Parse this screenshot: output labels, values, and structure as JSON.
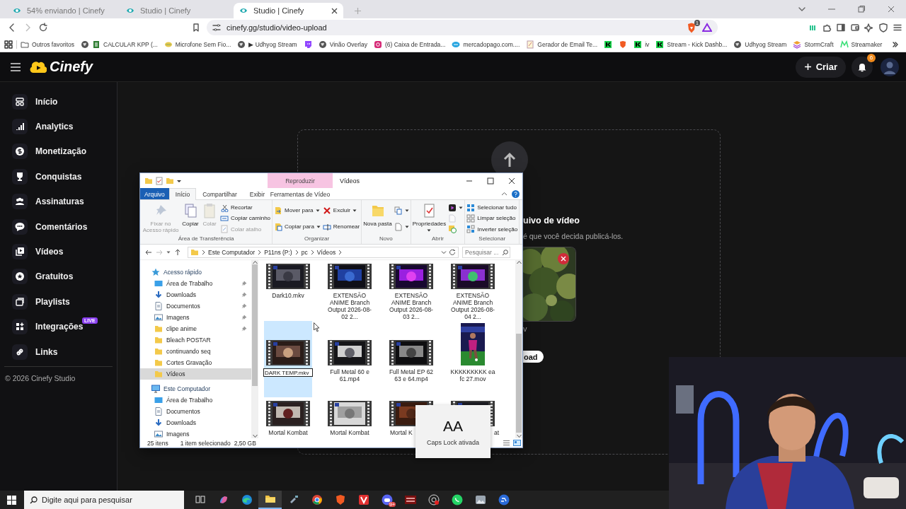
{
  "browser": {
    "tabs": [
      {
        "title": "54% enviando | Cinefy",
        "selected": false
      },
      {
        "title": "Studio | Cinefy",
        "selected": false
      },
      {
        "title": "Studio | Cinefy",
        "selected": true
      }
    ],
    "address": "cinefy.gg/studio/video-upload",
    "shield_count": "1",
    "bookmarks": [
      {
        "kind": "link",
        "label": "Outros favoritos"
      },
      {
        "kind": "link",
        "label": "CALCULAR KPP (..."
      },
      {
        "kind": "link",
        "label": "Microfone Sem Fio..."
      },
      {
        "kind": "link",
        "label": "▶ Udhyog Stream"
      },
      {
        "kind": "icon"
      },
      {
        "kind": "link",
        "label": "Vinão Overlay"
      },
      {
        "kind": "link",
        "label": "(6) Caixa de Entrada..."
      },
      {
        "kind": "link",
        "label": "mercadopago.com...."
      },
      {
        "kind": "link",
        "label": "Gerador de Email Te..."
      },
      {
        "kind": "icon"
      },
      {
        "kind": "icon"
      },
      {
        "kind": "link",
        "label": "iv"
      },
      {
        "kind": "link",
        "label": "Stream - Kick Dashb..."
      },
      {
        "kind": "link",
        "label": "Udhyog Stream"
      },
      {
        "kind": "link",
        "label": "StormCraft"
      },
      {
        "kind": "link",
        "label": "Streamaker"
      }
    ]
  },
  "studio": {
    "logo": "Cinefy",
    "create_button": "Criar",
    "notification_count": "6",
    "nav": [
      {
        "label": "Início",
        "selected": false
      },
      {
        "label": "Analytics",
        "selected": false
      },
      {
        "label": "Monetização",
        "selected": false
      },
      {
        "label": "Conquistas",
        "selected": false
      },
      {
        "label": "Assinaturas",
        "selected": false
      },
      {
        "label": "Comentários",
        "selected": false
      },
      {
        "label": "Vídeos",
        "selected": false
      },
      {
        "label": "Gratuitos",
        "selected": false
      },
      {
        "label": "Playlists",
        "selected": false
      },
      {
        "label": "Integrações",
        "badge": "LIVE",
        "selected": false
      },
      {
        "label": "Links",
        "selected": false
      }
    ],
    "footer": "© 2026 Cinefy Studio",
    "upload": {
      "title": "uivo de vídeo",
      "subtitle": "é que você decida publicá-los.",
      "file_label": "v",
      "button": "oad"
    }
  },
  "explorer": {
    "title": "Vídeos",
    "context_group": "Reproduzir",
    "tabs": [
      {
        "label": "Arquivo",
        "kind": "file",
        "selected": false
      },
      {
        "label": "Início",
        "kind": "tab",
        "selected": true
      },
      {
        "label": "Compartilhar",
        "kind": "tab",
        "selected": false
      },
      {
        "label": "Exibir",
        "kind": "tab",
        "selected": false
      },
      {
        "label": "Ferramentas de Vídeo",
        "kind": "context",
        "selected": false
      }
    ],
    "ribbon": [
      {
        "label": "Área de Transferência",
        "commands": [
          {
            "kind": "large",
            "label": "Fixar no Acesso rápido",
            "disabled": true,
            "dropdown": false
          },
          {
            "kind": "large",
            "label": "Copiar",
            "disabled": false,
            "dropdown": false
          },
          {
            "kind": "large",
            "label": "Colar",
            "disabled": true,
            "dropdown": false
          },
          {
            "kind": "small",
            "label": "Recortar",
            "disabled": false,
            "dropdown": false
          },
          {
            "kind": "small",
            "label": "Copiar caminho",
            "disabled": false,
            "dropdown": false
          },
          {
            "kind": "small",
            "label": "Colar atalho",
            "disabled": true,
            "dropdown": false
          }
        ]
      },
      {
        "label": "Organizar",
        "commands": [
          {
            "kind": "small",
            "label": "Mover para",
            "disabled": false,
            "dropdown": true
          },
          {
            "kind": "small",
            "label": "Copiar para",
            "disabled": false,
            "dropdown": true
          },
          {
            "kind": "small",
            "label": "Excluir",
            "disabled": false,
            "dropdown": true
          },
          {
            "kind": "small",
            "label": "Renomear",
            "disabled": false,
            "dropdown": false
          }
        ]
      },
      {
        "label": "Novo",
        "commands": [
          {
            "kind": "large",
            "label": "Nova pasta",
            "disabled": false,
            "dropdown": false
          },
          {
            "kind": "icon",
            "disabled": false,
            "dropdown": true
          },
          {
            "kind": "icon",
            "disabled": false,
            "dropdown": true
          }
        ]
      },
      {
        "label": "Abrir",
        "commands": [
          {
            "kind": "large",
            "label": "Propriedades",
            "disabled": false,
            "dropdown": true
          },
          {
            "kind": "icon",
            "disabled": false,
            "dropdown": true
          },
          {
            "kind": "icon",
            "disabled": true,
            "dropdown": false
          },
          {
            "kind": "icon",
            "disabled": false,
            "dropdown": false
          }
        ]
      },
      {
        "label": "Selecionar",
        "commands": [
          {
            "kind": "small",
            "label": "Selecionar tudo",
            "disabled": false,
            "dropdown": false
          },
          {
            "kind": "small",
            "label": "Limpar seleção",
            "disabled": false,
            "dropdown": false
          },
          {
            "kind": "small",
            "label": "Inverter seleção",
            "disabled": false,
            "dropdown": false
          }
        ]
      }
    ],
    "address": [
      "Este Computador",
      "P11ns (P:)",
      "pc",
      "Vídeos"
    ],
    "search_placeholder": "Pesquisar ...",
    "tree": [
      {
        "label": "Acesso rápido",
        "kind": "quick",
        "selected": false,
        "children": [
          {
            "label": "Área de Trabalho",
            "kind": "desktop",
            "pinned": true,
            "selected": false
          },
          {
            "label": "Downloads",
            "kind": "downloads",
            "pinned": true,
            "selected": false
          },
          {
            "label": "Documentos",
            "kind": "documents",
            "pinned": true,
            "selected": false
          },
          {
            "label": "Imagens",
            "kind": "pictures",
            "pinned": true,
            "selected": false
          },
          {
            "label": "clipe anime",
            "kind": "folder",
            "pinned": true,
            "selected": false
          },
          {
            "label": "Bleach POSTAR",
            "kind": "folder",
            "pinned": false,
            "selected": false
          },
          {
            "label": "continuando seq",
            "kind": "folder",
            "pinned": false,
            "selected": false
          },
          {
            "label": "Cortes Gravação",
            "kind": "folder",
            "pinned": false,
            "selected": false
          },
          {
            "label": "Vídeos",
            "kind": "folder",
            "pinned": false,
            "selected": true
          }
        ]
      },
      {
        "label": "Este Computador",
        "kind": "computer",
        "selected": false,
        "children": [
          {
            "label": "Área de Trabalho",
            "kind": "desktop",
            "pinned": false,
            "selected": false
          },
          {
            "label": "Documentos",
            "kind": "documents",
            "pinned": false,
            "selected": false
          },
          {
            "label": "Downloads",
            "kind": "downloads",
            "pinned": false,
            "selected": false
          },
          {
            "label": "Imagens",
            "kind": "pictures",
            "pinned": false,
            "selected": false
          }
        ]
      }
    ],
    "files": [
      {
        "name": "Dark10.mkv",
        "kind": "video",
        "selected": false,
        "renaming": false,
        "cut_start": false,
        "cut_end": false
      },
      {
        "name": "EXTENSÃO ANIME Branch Output 2026-08-02 2...",
        "kind": "video",
        "selected": false,
        "renaming": false,
        "cut_start": false,
        "cut_end": false
      },
      {
        "name": "EXTENSÃO ANIME Branch Output 2026-08-03 2...",
        "kind": "video",
        "selected": false,
        "renaming": false,
        "cut_start": false,
        "cut_end": false
      },
      {
        "name": "EXTENSÃO ANIME Branch Output 2026-08-04 2...",
        "kind": "video",
        "selected": false,
        "renaming": false,
        "cut_start": false,
        "cut_end": false
      },
      {
        "name": "DARK TEMP.mkv",
        "kind": "video",
        "selected": true,
        "renaming": true,
        "cut_start": false,
        "cut_end": false
      },
      {
        "name": "Full Metal 60 e 61.mp4",
        "kind": "video",
        "selected": false,
        "renaming": false,
        "cut_start": false,
        "cut_end": false
      },
      {
        "name": "Full Metal EP 62 63 e 64.mp4",
        "kind": "video",
        "selected": false,
        "renaming": false,
        "cut_start": false,
        "cut_end": false
      },
      {
        "name": "KKKKKKKKK ea fc 27.mov",
        "kind": "portrait",
        "selected": false,
        "renaming": false,
        "cut_start": false,
        "cut_end": false
      },
      {
        "name": "Mortal Kombat",
        "kind": "video",
        "selected": false,
        "renaming": false,
        "cut_start": false,
        "cut_end": false
      },
      {
        "name": "Mortal Kombat",
        "kind": "video",
        "selected": false,
        "renaming": false,
        "cut_start": false,
        "cut_end": false
      },
      {
        "name": "Mortal K",
        "kind": "video",
        "selected": false,
        "renaming": false,
        "cut_start": false,
        "cut_end": true
      },
      {
        "name": "at",
        "kind": "video",
        "selected": false,
        "renaming": false,
        "cut_start": true,
        "cut_end": false
      }
    ],
    "status": {
      "count": "25 itens",
      "selection": "1 item selecionado",
      "size": "2,50 GB"
    }
  },
  "caps_toast": {
    "glyph": "AA",
    "message": "Caps Lock ativada"
  },
  "taskbar": {
    "search_placeholder": "Digite aqui para pesquisar",
    "apps": [
      {
        "active": false
      },
      {
        "active": false
      },
      {
        "active": false
      },
      {
        "active": true
      },
      {
        "active": false
      },
      {
        "active": false
      },
      {
        "active": false
      },
      {
        "active": false
      },
      {
        "active": false,
        "badge": "9+"
      },
      {
        "active": false
      },
      {
        "active": false
      },
      {
        "active": false
      },
      {
        "active": false
      },
      {
        "active": false
      }
    ]
  }
}
